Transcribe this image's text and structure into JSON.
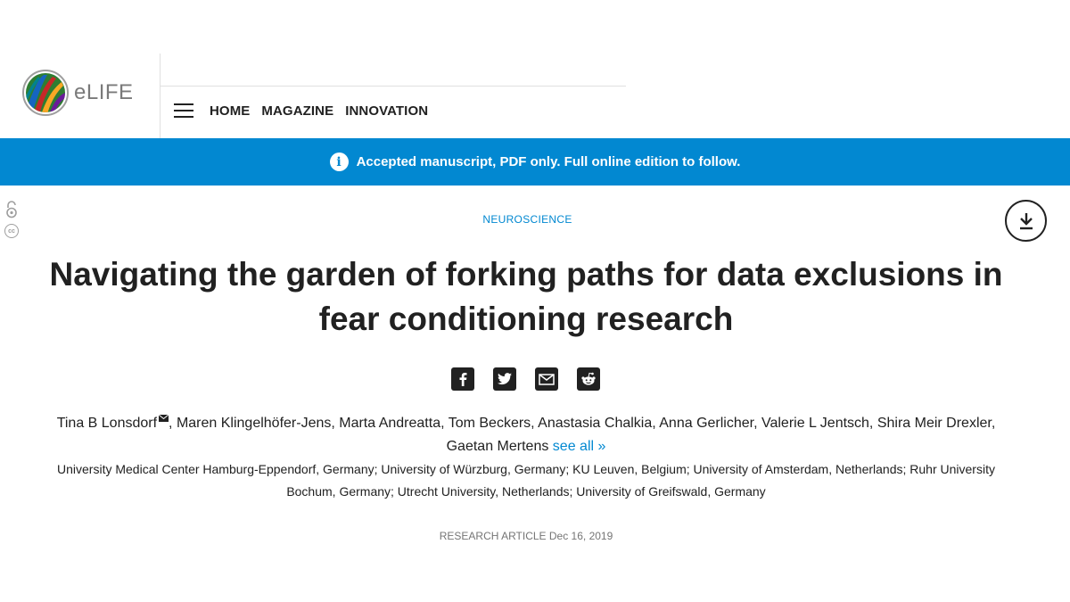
{
  "brand": {
    "logo_text": "eLIFE"
  },
  "nav": {
    "items": [
      "HOME",
      "MAGAZINE",
      "INNOVATION"
    ]
  },
  "banner": {
    "text": "Accepted manuscript, PDF only. Full online edition to follow."
  },
  "article": {
    "subject": "NEUROSCIENCE",
    "title_line1": "Navigating the garden of forking paths for data exclusions in",
    "title_line2": "fear conditioning research",
    "authors_line1": ", Maren Klingelhöfer-Jens, Marta Andreatta, Tom Beckers, Anastasia Chalkia, Anna Gerlicher, Valerie L Jentsch, Shira Meir Drexler,",
    "first_author": "Tina B Lonsdorf",
    "authors_line2": "Gaetan Mertens",
    "see_all": "see all »",
    "affiliations_line1": "University Medical Center Hamburg-Eppendorf, Germany; University of Würzburg, Germany; KU Leuven, Belgium; University of Amsterdam, Netherlands; Ruhr University",
    "affiliations_line2": "Bochum, Germany; Utrecht University, Netherlands; University of Greifswald, Germany",
    "type": "RESEARCH ARTICLE",
    "date": "Dec 16, 2019"
  },
  "icons": {
    "share": [
      "facebook-icon",
      "twitter-icon",
      "email-icon",
      "reddit-icon"
    ],
    "side": [
      "open-access-icon",
      "creative-commons-icon"
    ]
  },
  "colors": {
    "accent": "#0288d1",
    "text": "#212121",
    "muted": "#757575"
  }
}
